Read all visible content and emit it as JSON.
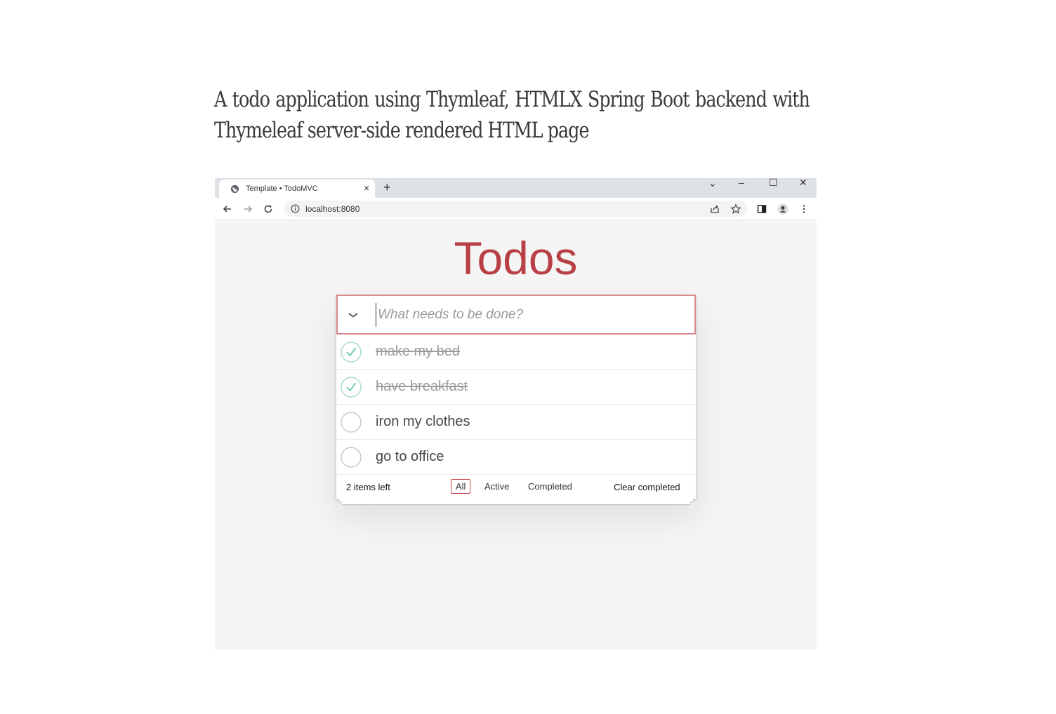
{
  "caption": "A todo application using Thymleaf, HTMLX Spring Boot backend with Thymeleaf server-side rendered HTML page",
  "browser": {
    "tab_title": "Template • TodoMVC",
    "tab_close": "×",
    "new_tab": "+",
    "window_controls": {
      "dropdown": "⌄",
      "minimize": "–",
      "maximize": "☐",
      "close": "✕"
    },
    "url": "localhost:8080"
  },
  "app": {
    "title": "Todos",
    "new_todo_placeholder": "What needs to be done?",
    "todos": [
      {
        "text": "make my bed",
        "completed": true
      },
      {
        "text": "have breakfast",
        "completed": true
      },
      {
        "text": "iron my clothes",
        "completed": false
      },
      {
        "text": "go to office",
        "completed": false
      }
    ],
    "footer": {
      "items_left": "2 items left",
      "filters": [
        "All",
        "Active",
        "Completed"
      ],
      "selected_filter": "All",
      "clear_completed": "Clear completed"
    }
  },
  "colors": {
    "accent": "#b83f45",
    "check": "#5dc2af",
    "page_bg": "#f5f5f5"
  }
}
